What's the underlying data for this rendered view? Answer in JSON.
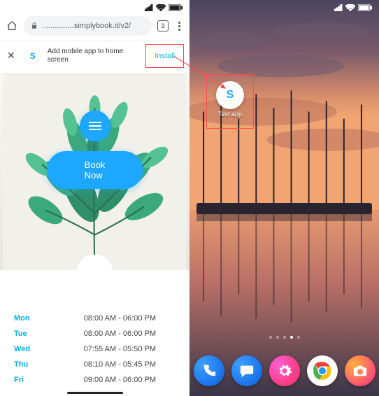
{
  "status": {
    "signal": "full",
    "wifi": "full",
    "battery": "full"
  },
  "browser": {
    "url": "...............simplybook.it/v2/",
    "tab_count": "3"
  },
  "install_banner": {
    "text": "Add mobile app to home screen",
    "button": "Install",
    "logo_glyph": "S"
  },
  "hero": {
    "book_button": "Book Now"
  },
  "hours": [
    {
      "day": "Mon",
      "time": "08:00 AM - 06:00 PM"
    },
    {
      "day": "Tue",
      "time": "08:00 AM - 06:00 PM"
    },
    {
      "day": "Wed",
      "time": "07:55 AM - 05:50 PM"
    },
    {
      "day": "Thu",
      "time": "08:10 AM - 05:45 PM"
    },
    {
      "day": "Fri",
      "time": "09:00 AM - 06:00 PM"
    }
  ],
  "homescreen": {
    "app": {
      "glyph": "S",
      "label": "Test app"
    },
    "dock": [
      "phone",
      "messages",
      "settings",
      "chrome",
      "camera"
    ]
  },
  "colors": {
    "accent": "#1ea7ff",
    "highlight_border": "#ff4b4b"
  }
}
